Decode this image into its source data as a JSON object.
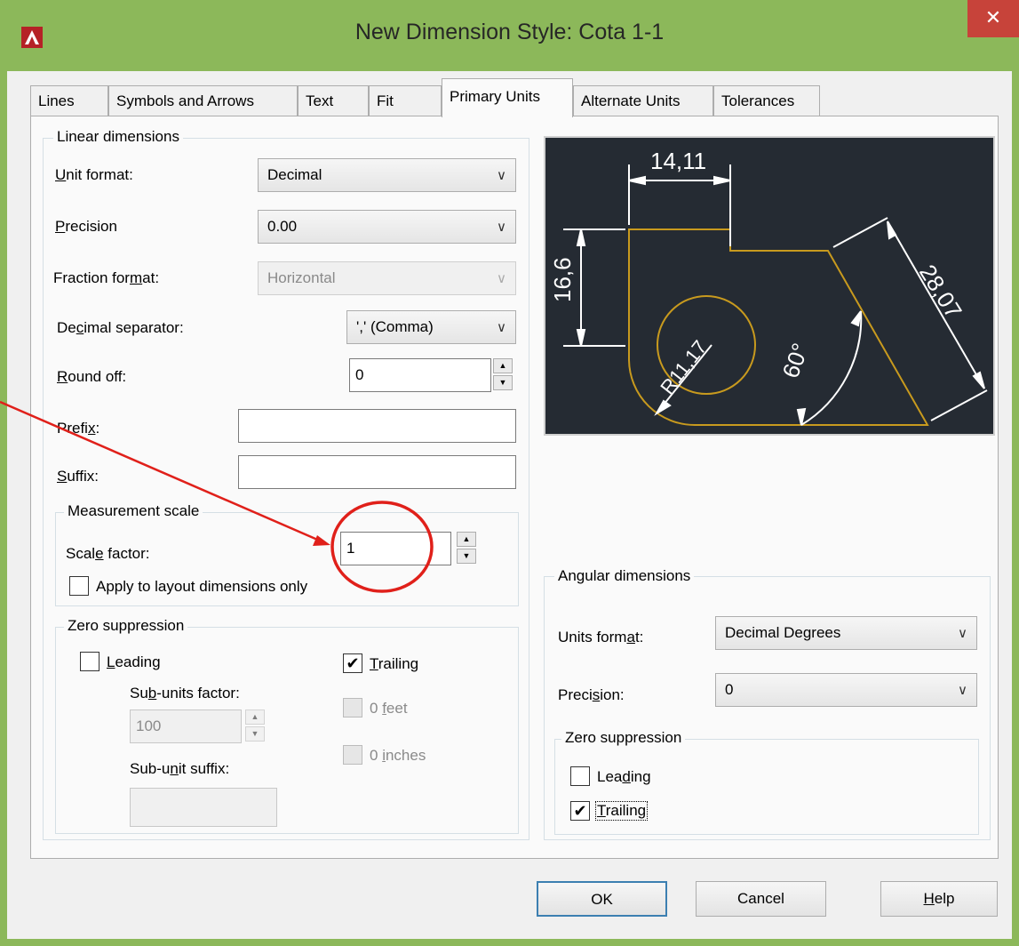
{
  "window": {
    "title": "New Dimension Style: Cota 1-1",
    "close_label": "✕"
  },
  "tabs": [
    "Lines",
    "Symbols and Arrows",
    "Text",
    "Fit",
    "Primary Units",
    "Alternate Units",
    "Tolerances"
  ],
  "active_tab": "Primary Units",
  "linear": {
    "group_title": "Linear dimensions",
    "unit_format": {
      "label_u": "U",
      "label_rest": "nit format:",
      "value": "Decimal"
    },
    "precision": {
      "label_u": "P",
      "label_rest": "recision",
      "value": "0.00"
    },
    "fraction_format": {
      "label_pre": "Fraction for",
      "label_u": "m",
      "label_rest": "at:",
      "value": "Horizontal"
    },
    "decimal_separator": {
      "label_pre": "De",
      "label_u": "c",
      "label_rest": "imal separator:",
      "value": "',' (Comma)"
    },
    "round_off": {
      "label_u": "R",
      "label_rest": "ound off:",
      "value": "0"
    },
    "prefix": {
      "label_pre": "Prefi",
      "label_u": "x",
      "label_rest": ":",
      "value": ""
    },
    "suffix": {
      "label_u": "S",
      "label_rest": "uffix:",
      "value": ""
    }
  },
  "measurement_scale": {
    "group_title": "Measurement scale",
    "scale_factor": {
      "label_pre": "Scal",
      "label_u": "e",
      "label_rest": " factor:",
      "value": "1"
    },
    "apply_layout_label": "Apply to layout dimensions only",
    "apply_layout_checked": false
  },
  "zero_suppression": {
    "group_title": "Zero suppression",
    "leading": {
      "label_u": "L",
      "label_rest": "eading",
      "checked": false
    },
    "trailing": {
      "label_u": "T",
      "label_rest": "railing",
      "checked": true
    },
    "sub_units_factor": {
      "label_pre": "Su",
      "label_u": "b",
      "label_rest": "-units factor:",
      "value": "100"
    },
    "sub_unit_suffix": {
      "label_pre": "Sub-u",
      "label_u": "n",
      "label_rest": "it suffix:",
      "value": ""
    },
    "feet": {
      "label_pre": "0 ",
      "label_u": "f",
      "label_rest": "eet",
      "checked": false
    },
    "inches": {
      "label_pre": "0 ",
      "label_u": "i",
      "label_rest": "nches",
      "checked": false
    }
  },
  "preview": {
    "dim_top": "14,11",
    "dim_left": "16,6",
    "dim_diag": "28,07",
    "radius": "R11,17",
    "angle": "60°"
  },
  "angular": {
    "group_title": "Angular dimensions",
    "units_format": {
      "label_pre": "Units form",
      "label_u": "a",
      "label_rest": "t:",
      "value": "Decimal Degrees"
    },
    "precision": {
      "label_pre": "Preci",
      "label_u": "s",
      "label_rest": "ion:",
      "value": "0"
    },
    "zero_title": "Zero suppression",
    "leading": {
      "label_pre": "Lea",
      "label_u": "d",
      "label_rest": "ing",
      "checked": false
    },
    "trailing": {
      "label_u": "T",
      "label_rest": "railing",
      "checked": true
    }
  },
  "buttons": {
    "ok": "OK",
    "cancel": "Cancel",
    "help_u": "H",
    "help_rest": "elp"
  },
  "colors": {
    "title_bar": "#8cb85a",
    "close": "#c7433a",
    "annotation": "#e0201a",
    "preview_bg": "#252b33",
    "preview_geometry": "#c89a1e"
  }
}
